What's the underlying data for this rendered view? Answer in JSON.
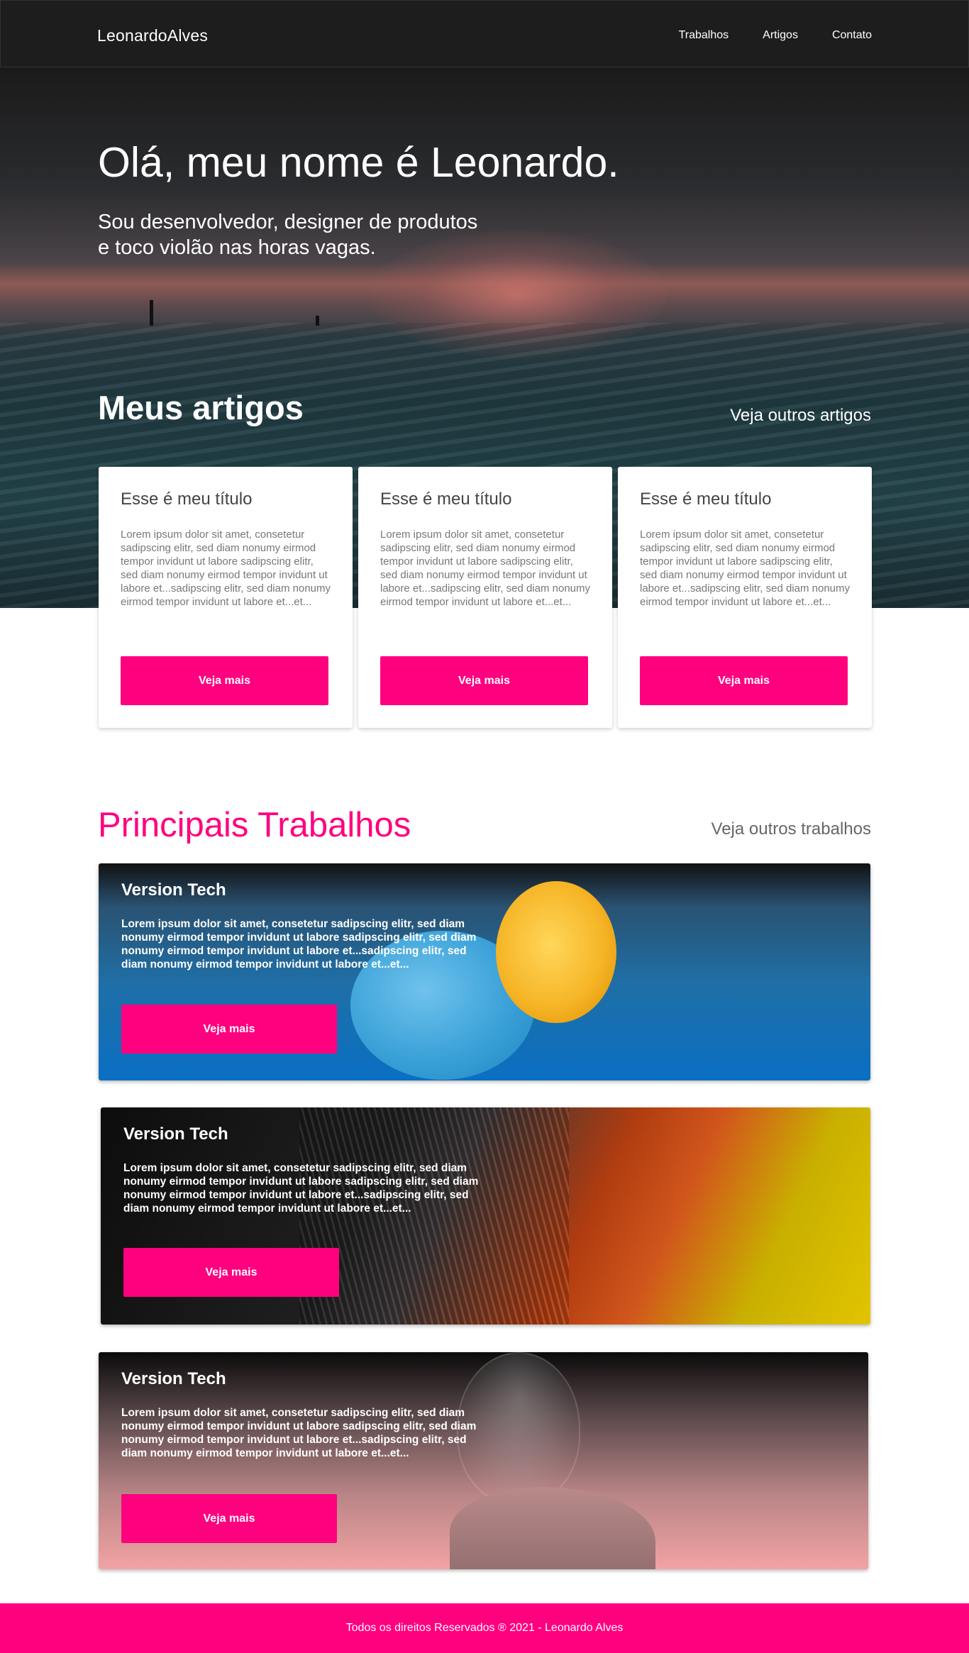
{
  "header": {
    "logo": "LeonardoAlves",
    "nav": [
      "Trabalhos",
      "Artigos",
      "Contato"
    ]
  },
  "hero": {
    "title": "Olá, meu nome é Leonardo.",
    "subtitle_line1": "Sou desenvolvedor, designer de produtos",
    "subtitle_line2": "e toco violão nas horas vagas."
  },
  "articles": {
    "section_title": "Meus artigos",
    "more_link": "Veja outros artigos",
    "cards": [
      {
        "title": "Esse é meu título",
        "text": "Lorem ipsum dolor sit amet, consetetur sadipscing elitr, sed diam nonumy eirmod tempor invidunt ut labore sadipscing elitr, sed diam nonumy eirmod tempor invidunt ut labore et...sadipscing elitr, sed diam nonumy eirmod tempor invidunt ut labore et...et...",
        "button": "Veja mais"
      },
      {
        "title": "Esse é meu título",
        "text": "Lorem ipsum dolor sit amet, consetetur sadipscing elitr, sed diam nonumy eirmod tempor invidunt ut labore sadipscing elitr, sed diam nonumy eirmod tempor invidunt ut labore et...sadipscing elitr, sed diam nonumy eirmod tempor invidunt ut labore et...et...",
        "button": "Veja mais"
      },
      {
        "title": "Esse é meu título",
        "text": "Lorem ipsum dolor sit amet, consetetur sadipscing elitr, sed diam nonumy eirmod tempor invidunt ut labore sadipscing elitr, sed diam nonumy eirmod tempor invidunt ut labore et...sadipscing elitr, sed diam nonumy eirmod tempor invidunt ut labore et...et...",
        "button": "Veja mais"
      }
    ]
  },
  "works": {
    "section_title": "Principais Trabalhos",
    "more_link": "Veja outros trabalhos",
    "items": [
      {
        "title": "Version Tech",
        "text": "Lorem ipsum dolor sit amet, consetetur sadipscing elitr, sed diam nonumy eirmod tempor invidunt ut labore sadipscing elitr, sed diam nonumy eirmod tempor invidunt ut labore et...sadipscing elitr, sed diam nonumy eirmod tempor invidunt ut labore et...et...",
        "button": "Veja mais"
      },
      {
        "title": "Version Tech",
        "text": "Lorem ipsum dolor sit amet, consetetur sadipscing elitr, sed diam nonumy eirmod tempor invidunt ut labore sadipscing elitr, sed diam nonumy eirmod tempor invidunt ut labore et...sadipscing elitr, sed diam nonumy eirmod tempor invidunt ut labore et...et...",
        "button": "Veja mais"
      },
      {
        "title": "Version Tech",
        "text": "Lorem ipsum dolor sit amet, consetetur sadipscing elitr, sed diam nonumy eirmod tempor invidunt ut labore sadipscing elitr, sed diam nonumy eirmod tempor invidunt ut labore et...sadipscing elitr, sed diam nonumy eirmod tempor invidunt ut labore et...et...",
        "button": "Veja mais"
      }
    ]
  },
  "footer": {
    "text": "Todos os direitos Reservados ® 2021 - Leonardo Alves"
  },
  "colors": {
    "accent": "#ff007f",
    "header_bg": "#1d1d1d"
  }
}
